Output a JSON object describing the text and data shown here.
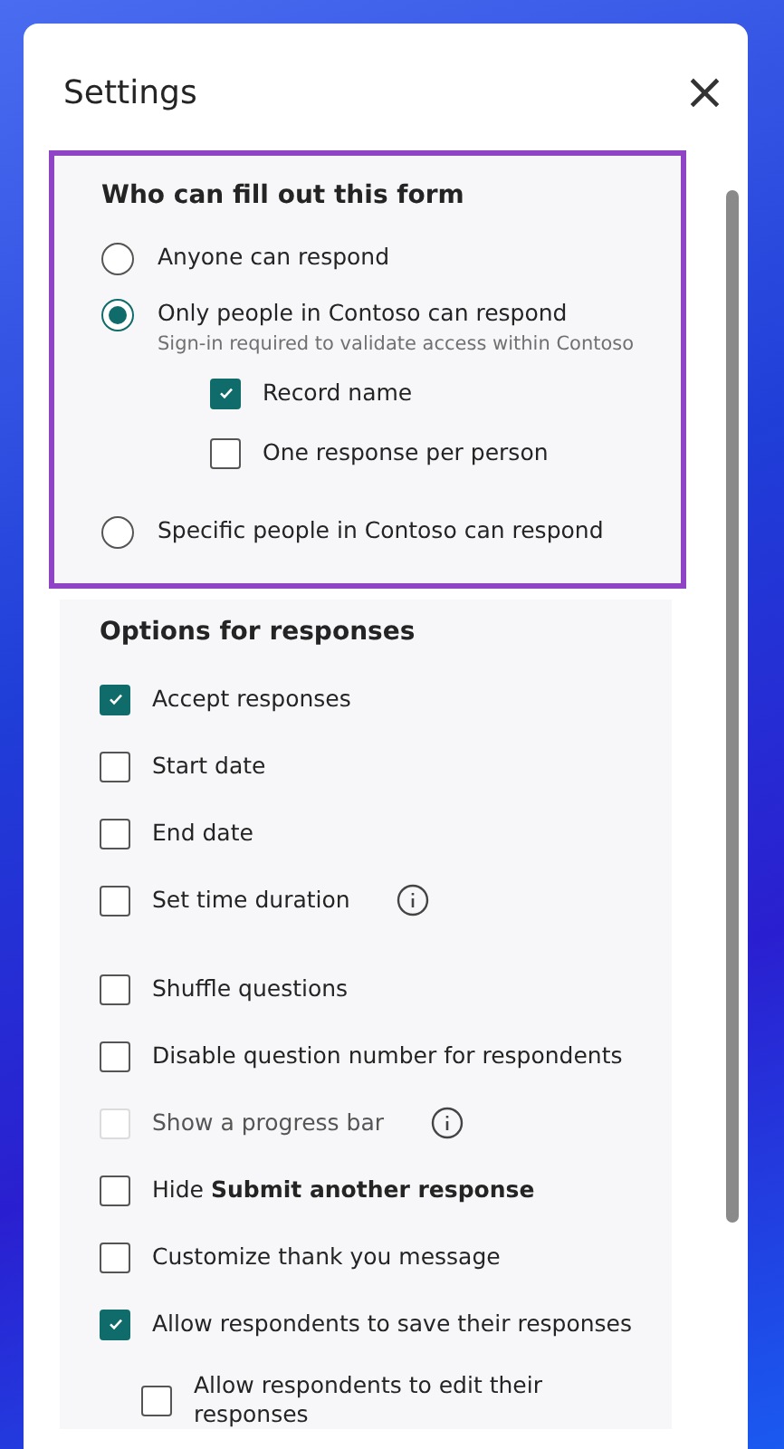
{
  "dialog": {
    "title": "Settings",
    "close": "×"
  },
  "who": {
    "heading": "Who can fill out this form",
    "highlighted": true,
    "options": [
      {
        "label": "Anyone can respond",
        "selected": false
      },
      {
        "label": "Only people in Contoso can respond",
        "selected": true,
        "hint": "Sign-in required to validate access within Contoso",
        "children": [
          {
            "label": "Record name",
            "checked": true
          },
          {
            "label": "One response per person",
            "checked": false
          }
        ]
      },
      {
        "label": "Specific people in Contoso can respond",
        "selected": false
      }
    ]
  },
  "responses": {
    "heading": "Options for responses",
    "groups": [
      {
        "items": [
          {
            "label": "Accept responses",
            "checked": true
          },
          {
            "label": "Start date",
            "checked": false
          },
          {
            "label": "End date",
            "checked": false
          },
          {
            "label": "Set time duration",
            "checked": false,
            "info": true
          }
        ]
      },
      {
        "items": [
          {
            "label": "Shuffle questions",
            "checked": false
          },
          {
            "label": "Disable question number for respondents",
            "checked": false
          },
          {
            "label": "Show a progress bar",
            "checked": false,
            "disabled": true,
            "info": true
          },
          {
            "label": "Hide **Submit another response**",
            "checked": false
          },
          {
            "label": "Customize thank you message",
            "checked": false
          },
          {
            "label": "Allow respondents to save their responses",
            "checked": true,
            "children": [
              {
                "label": "Allow respondents to edit their responses",
                "checked": false
              }
            ]
          }
        ]
      }
    ]
  }
}
